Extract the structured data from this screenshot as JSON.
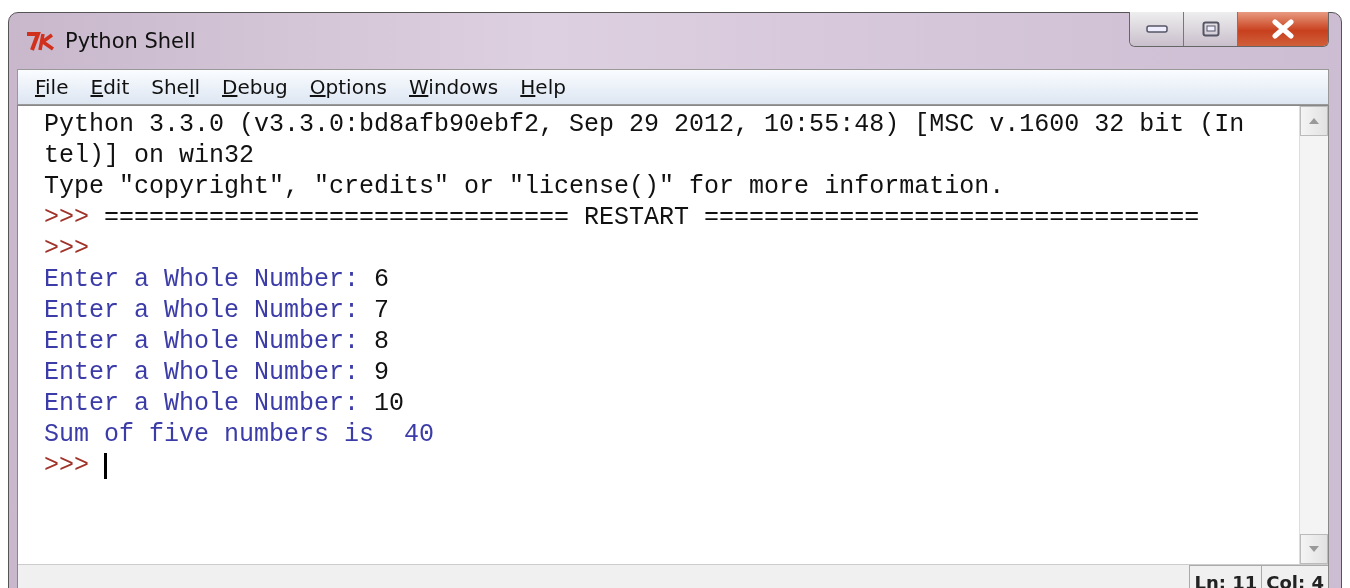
{
  "window": {
    "title": "Python Shell"
  },
  "menu": [
    {
      "access_key": "F",
      "rest": "ile"
    },
    {
      "access_key": "E",
      "rest": "dit"
    },
    {
      "before": "She",
      "access_key": "l",
      "rest": "l"
    },
    {
      "access_key": "D",
      "rest": "ebug"
    },
    {
      "access_key": "O",
      "rest": "ptions"
    },
    {
      "access_key": "W",
      "rest": "indows"
    },
    {
      "access_key": "H",
      "rest": "elp"
    }
  ],
  "shell_lines": [
    [
      {
        "kind": "output",
        "text": "Python 3.3.0 (v3.3.0:bd8afb90ebf2, Sep 29 2012, 10:55:48) [MSC v.1600 32 bit (In"
      }
    ],
    [
      {
        "kind": "output",
        "text": "tel)] on win32"
      }
    ],
    [
      {
        "kind": "output",
        "text": "Type \"copyright\", \"credits\" or \"license()\" for more information."
      }
    ],
    [
      {
        "kind": "prompt",
        "text": ">>>"
      },
      {
        "kind": "output",
        "text": "=============================== RESTART ================================="
      }
    ],
    [
      {
        "kind": "prompt",
        "text": ">>>"
      }
    ],
    [
      {
        "kind": "stdout",
        "text": "Enter a Whole Number:"
      },
      {
        "kind": "input",
        "text": "6"
      }
    ],
    [
      {
        "kind": "stdout",
        "text": "Enter a Whole Number:"
      },
      {
        "kind": "input",
        "text": "7"
      }
    ],
    [
      {
        "kind": "stdout",
        "text": "Enter a Whole Number:"
      },
      {
        "kind": "input",
        "text": "8"
      }
    ],
    [
      {
        "kind": "stdout",
        "text": "Enter a Whole Number:"
      },
      {
        "kind": "input",
        "text": "9"
      }
    ],
    [
      {
        "kind": "stdout",
        "text": "Enter a Whole Number:"
      },
      {
        "kind": "input",
        "text": "10"
      }
    ],
    [
      {
        "kind": "stdout",
        "text": "Sum of five numbers is  40"
      }
    ],
    [
      {
        "kind": "prompt",
        "text": ">>>"
      },
      {
        "kind": "cursor"
      }
    ]
  ],
  "status_bar": {
    "line": "Ln: 11",
    "column": "Col: 4"
  }
}
